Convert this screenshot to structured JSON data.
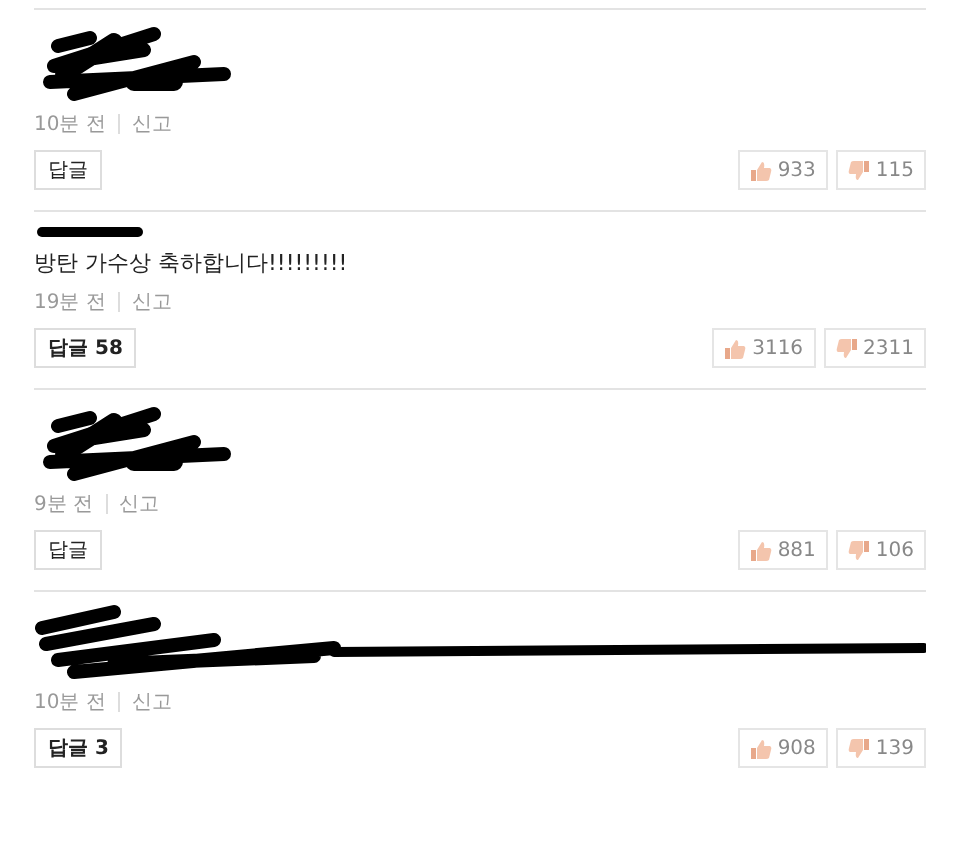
{
  "comments": [
    {
      "kind": "blob",
      "time": "10분 전",
      "report": "신고",
      "reply": {
        "label": "답글"
      },
      "likes": "933",
      "dislikes": "115"
    },
    {
      "kind": "bar",
      "text": "방탄 가수상 축하합니다!!!!!!!!!",
      "time": "19분 전",
      "report": "신고",
      "reply": {
        "label": "답글",
        "count": "58"
      },
      "likes": "3116",
      "dislikes": "2311"
    },
    {
      "kind": "blob",
      "time": "9분 전",
      "report": "신고",
      "reply": {
        "label": "답글"
      },
      "likes": "881",
      "dislikes": "106"
    },
    {
      "kind": "wide",
      "time": "10분 전",
      "report": "신고",
      "reply": {
        "label": "답글",
        "count": "3"
      },
      "likes": "908",
      "dislikes": "139"
    }
  ]
}
